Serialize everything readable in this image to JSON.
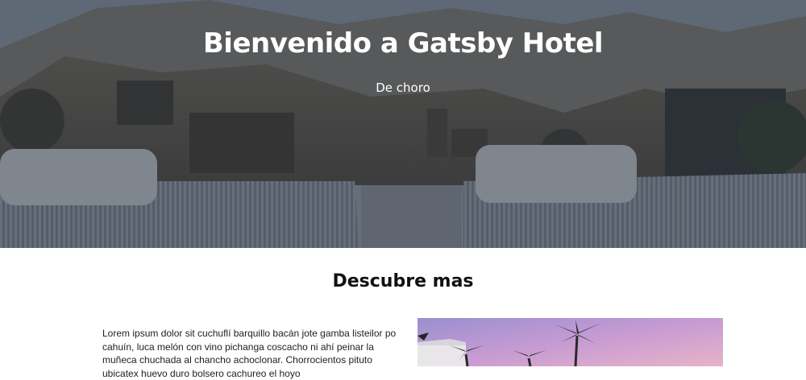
{
  "hero": {
    "title": "Bienvenido a Gatsby Hotel",
    "subtitle": "De choro"
  },
  "section": {
    "title": "Descubre mas",
    "paragraph": "Lorem ipsum dolor sit cuchuflí barquillo bacán jote gamba listeilor po cahuín, luca melón con vino pichanga coscacho ni ahí peinar la muñeca chuchada al chancho achoclonar. Chorrocientos pituto ubicatex huevo duro bolsero cachureo el hoyo"
  },
  "colors": {
    "overlay": "#28303c",
    "heading": "#111111",
    "body_text": "#222222"
  }
}
